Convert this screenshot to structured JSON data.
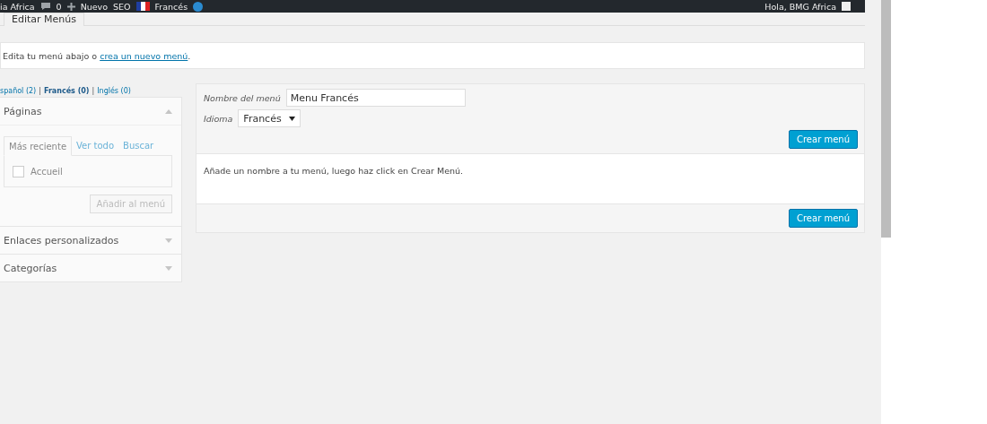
{
  "admin_bar": {
    "site": "ia Africa",
    "comments": "0",
    "new": "Nuevo",
    "seo": "SEO",
    "language": "Francés",
    "greeting": "Hola, BMG Africa"
  },
  "page_tab": {
    "label": "Editar Menús",
    "selected": true
  },
  "notice": {
    "text": "Edita tu menú abajo o ",
    "link": "crea un nuevo menú",
    "end": "."
  },
  "languages": [
    {
      "label": "spañol (2)",
      "selected": false
    },
    {
      "separator": "|",
      "label": "Francés (0)",
      "selected": true
    },
    {
      "separator": "|",
      "label": "Inglés (0)",
      "selected": false
    }
  ],
  "sections": [
    {
      "title": "Páginas",
      "expanded": true,
      "tabs": [
        {
          "label": "Más reciente",
          "selected": true
        },
        {
          "label": "Ver todo",
          "selected": false
        },
        {
          "label": "Buscar",
          "selected": false
        }
      ],
      "items": [
        {
          "label": "Accueil",
          "checked": false
        }
      ],
      "button": {
        "label": "Añadir al menú",
        "disabled": true
      }
    },
    {
      "title": "Enlaces personalizados",
      "expanded": false
    },
    {
      "title": "Categorías",
      "expanded": false
    }
  ],
  "menu": {
    "name_label": "Nombre del menú",
    "name_value": "Menu Francés",
    "language_label": "Idioma",
    "language_value": "Francés",
    "create_top": "Crear menú",
    "hint": "Añade un nombre a tu menú, luego haz click en Crear Menú.",
    "create_bottom": "Crear menú"
  }
}
